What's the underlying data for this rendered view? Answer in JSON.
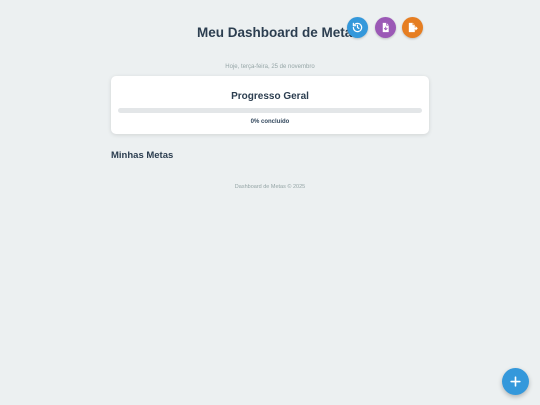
{
  "header": {
    "title": "Meu Dashboard de Metas",
    "date": "Hoje, terça-feira, 25 de novembro",
    "buttons": [
      {
        "icon": "history-icon",
        "color": "#3498db"
      },
      {
        "icon": "export-file-icon",
        "color": "#9b59b6"
      },
      {
        "icon": "import-file-icon",
        "color": "#e67e22"
      }
    ]
  },
  "progress": {
    "title": "Progresso Geral",
    "value_percent": 0,
    "label": "0% concluído"
  },
  "goals": {
    "title": "Minhas Metas",
    "items": []
  },
  "footer": {
    "text": "Dashboard de Metas © 2025"
  },
  "fab": {
    "icon": "plus-icon",
    "color": "#3498db"
  }
}
